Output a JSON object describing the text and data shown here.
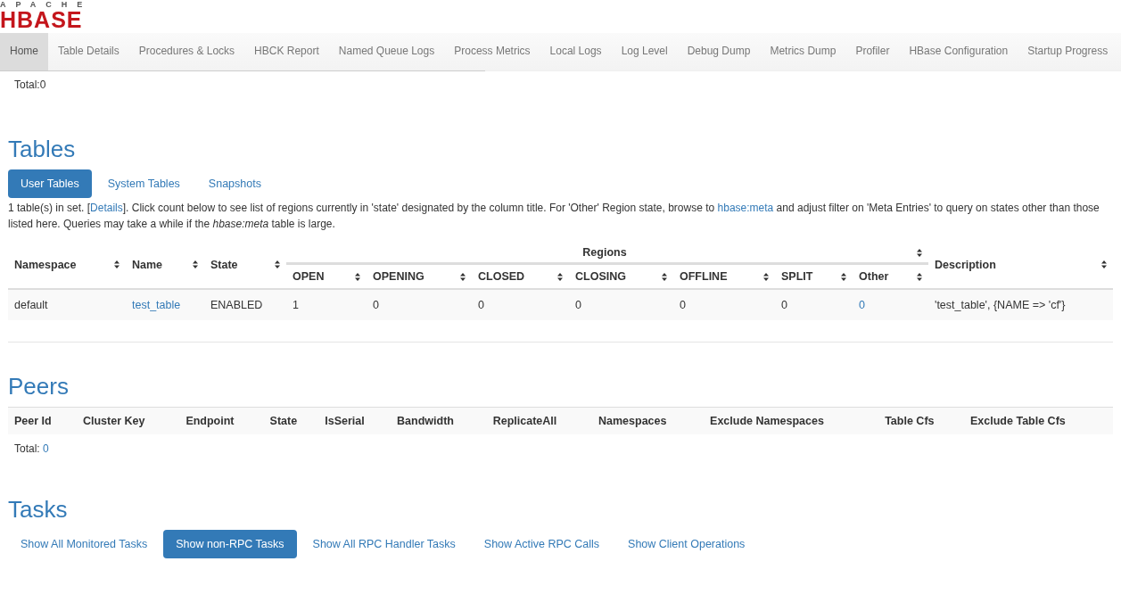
{
  "logo": {
    "top": "APACHE",
    "main": "HBASE"
  },
  "nav": [
    {
      "label": "Home",
      "selected": true
    },
    {
      "label": "Table Details",
      "selected": false
    },
    {
      "label": "Procedures & Locks",
      "selected": false
    },
    {
      "label": "HBCK Report",
      "selected": false
    },
    {
      "label": "Named Queue Logs",
      "selected": false
    },
    {
      "label": "Process Metrics",
      "selected": false
    },
    {
      "label": "Local Logs",
      "selected": false
    },
    {
      "label": "Log Level",
      "selected": false
    },
    {
      "label": "Debug Dump",
      "selected": false
    },
    {
      "label": "Metrics Dump",
      "selected": false
    },
    {
      "label": "Profiler",
      "selected": false
    },
    {
      "label": "HBase Configuration",
      "selected": false
    },
    {
      "label": "Startup Progress",
      "selected": false
    }
  ],
  "total_top": "Total:0",
  "tables": {
    "heading": "Tables",
    "tabs": [
      {
        "label": "User Tables",
        "selected": true
      },
      {
        "label": "System Tables",
        "selected": false
      },
      {
        "label": "Snapshots",
        "selected": false
      }
    ],
    "info": [
      {
        "kind": "text",
        "text": "1 table(s) in set. ["
      },
      {
        "kind": "link",
        "text": "Details"
      },
      {
        "kind": "text",
        "text": "]. Click count below to see list of regions currently in 'state' designated by the column title. For 'Other' Region state, browse to "
      },
      {
        "kind": "link",
        "text": "hbase:meta"
      },
      {
        "kind": "text",
        "text": " and adjust filter on 'Meta Entries' to query on states other than those listed here. Queries may take a while if the *hbase:meta* table is large."
      }
    ],
    "columns": [
      "Namespace",
      "Name",
      "State"
    ],
    "group": "Regions",
    "region_columns": [
      "OPEN",
      "OPENING",
      "CLOSED",
      "CLOSING",
      "OFFLINE",
      "SPLIT",
      "Other"
    ],
    "last_column": "Description",
    "rows": [
      [
        {
          "kind": "text",
          "text": "default"
        },
        {
          "kind": "link",
          "text": "test_table"
        },
        {
          "kind": "text",
          "text": "ENABLED"
        },
        {
          "kind": "text",
          "text": "1"
        },
        {
          "kind": "text",
          "text": "0"
        },
        {
          "kind": "text",
          "text": "0"
        },
        {
          "kind": "text",
          "text": "0"
        },
        {
          "kind": "text",
          "text": "0"
        },
        {
          "kind": "text",
          "text": "0"
        },
        {
          "kind": "link",
          "text": "0"
        },
        {
          "kind": "text",
          "text": "'test_table', {NAME => 'cf'}"
        }
      ]
    ]
  },
  "peers": {
    "heading": "Peers",
    "columns": [
      "Peer Id",
      "Cluster Key",
      "Endpoint",
      "State",
      "IsSerial",
      "Bandwidth",
      "ReplicateAll",
      "Namespaces",
      "Exclude Namespaces",
      "Table Cfs",
      "Exclude Table Cfs"
    ],
    "total_label": "Total:",
    "total_value": "0"
  },
  "tasks": {
    "heading": "Tasks",
    "tabs": [
      {
        "label": "Show All Monitored Tasks",
        "selected": false
      },
      {
        "label": "Show non-RPC Tasks",
        "selected": true
      },
      {
        "label": "Show All RPC Handler Tasks",
        "selected": false
      },
      {
        "label": "Show Active RPC Calls",
        "selected": false
      },
      {
        "label": "Show Client Operations",
        "selected": false
      }
    ]
  }
}
